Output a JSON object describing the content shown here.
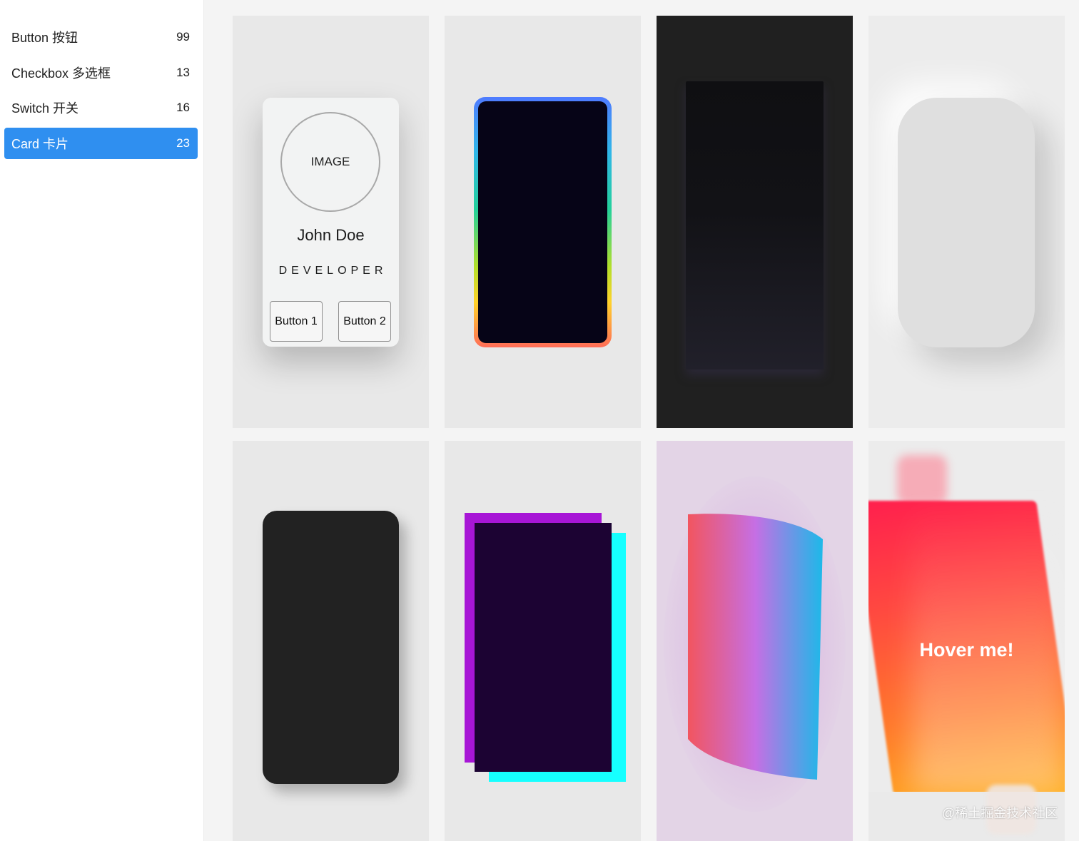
{
  "sidebar": {
    "items": [
      {
        "label": "Button 按钮",
        "count": "99"
      },
      {
        "label": "Checkbox 多选框",
        "count": "13"
      },
      {
        "label": "Switch 开关",
        "count": "16"
      },
      {
        "label": "Card 卡片",
        "count": "23"
      }
    ],
    "active_index": 3,
    "active_color": "#2f8ff0"
  },
  "cards": {
    "profile": {
      "image_label": "IMAGE",
      "name": "John Doe",
      "role": "DEVELOPER",
      "button1": "Button 1",
      "button2": "Button 2"
    },
    "hover": {
      "text": "Hover me!"
    }
  },
  "colors": {
    "rainbow_start": "#4f7bff",
    "rainbow_end": "#ff6d58",
    "glitch_purple": "#a716d6",
    "glitch_cyan": "#16ffff",
    "glitch_dark": "#1c0333",
    "hover_top": "#ff1f4e",
    "hover_bottom": "#ffae1a"
  },
  "watermark": "@稀土掘金技术社区"
}
